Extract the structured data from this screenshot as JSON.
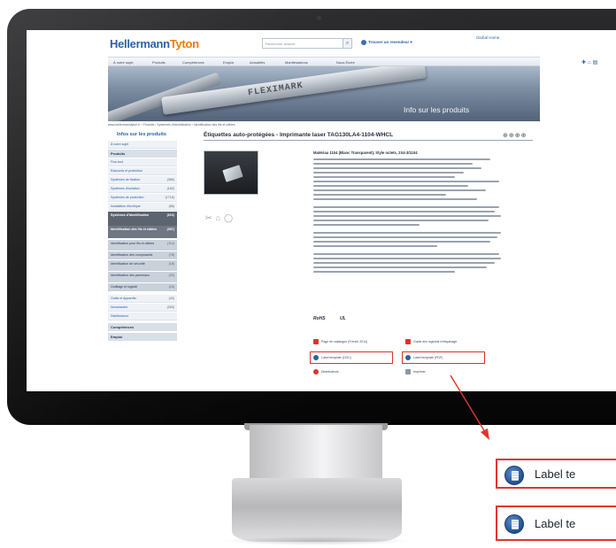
{
  "header": {
    "logo_part1": "Hellermann",
    "logo_part2": "Tyton",
    "search_placeholder": "Recherche avancé",
    "find_reseller": "Trouver un revendeur",
    "global_home": "Global Home"
  },
  "nav": {
    "items": [
      "À notre sujet",
      "Produits",
      "Compétences",
      "Emploi",
      "Actualités",
      "Manifestations",
      "Nous Écrire"
    ]
  },
  "banner": {
    "strap_text": "FLEXIMARK",
    "info_link": "Info sur les produits"
  },
  "breadcrumb": "www.hellermanntyton.fr › Produits › Systèmes d'identification › Identification des fils et câbles",
  "sidebar": {
    "title": "Infos sur les produits",
    "back": "À notre sujet",
    "section": "Produits",
    "items": [
      {
        "label": "Fixe-tout",
        "count": ""
      },
      {
        "label": "Raccords et protection",
        "count": ""
      },
      {
        "label": "Systèmes de fixation",
        "count": "(366)"
      },
      {
        "label": "Systèmes d'isolation",
        "count": "(162)"
      },
      {
        "label": "Systèmes de protection",
        "count": "(1716)"
      },
      {
        "label": "Installation électrique",
        "count": "(88)"
      },
      {
        "label": "Systèmes d'identification",
        "count": "(616)"
      },
      {
        "label": "Identification des fils et câbles",
        "count": "(397)"
      },
      {
        "label": "Identification pour fils et câbles",
        "count": "(114)"
      },
      {
        "label": "Identification des composants",
        "count": "(78)"
      },
      {
        "label": "Identification de sécurité",
        "count": "(18)"
      },
      {
        "label": "Identification des panneaux",
        "count": "(33)"
      },
      {
        "label": "Outillage et logiciel",
        "count": "(16)"
      },
      {
        "label": "Outils et Appareils",
        "count": "(43)"
      },
      {
        "label": "Nouveautés",
        "count": "(263)"
      },
      {
        "label": "Distributeurs",
        "count": ""
      }
    ],
    "footer_items": [
      "Compétences",
      "Emploi"
    ]
  },
  "content": {
    "title": "Étiquettes auto-protégées - Imprimante laser TAG130LA4-1104-WHCL",
    "title_icons": "⊕⊕⊕⊕",
    "desc_head": "Matériau 1104 (Blanc Transparent), Style octets, 2X4-3/1104",
    "certs": [
      "RoHS",
      "UL"
    ],
    "downloads": [
      {
        "label": "Page de catalogue (French 2014)",
        "icon": "pdf-icon"
      },
      {
        "label": "Guide des logiciels d'étiquetage",
        "icon": "pdf-icon"
      },
      {
        "label": "Label template (DOC)",
        "icon": "template-icon"
      },
      {
        "label": "Label template (PDF)",
        "icon": "template-icon"
      },
      {
        "label": "Distributeurs",
        "icon": "location-icon"
      },
      {
        "label": "Imprimer",
        "icon": "print-icon"
      }
    ]
  },
  "callouts": [
    "Label te",
    "Label te"
  ],
  "colors": {
    "brand_blue": "#2b62a6",
    "brand_orange": "#f07c00",
    "annotation_red": "#e2342c"
  }
}
